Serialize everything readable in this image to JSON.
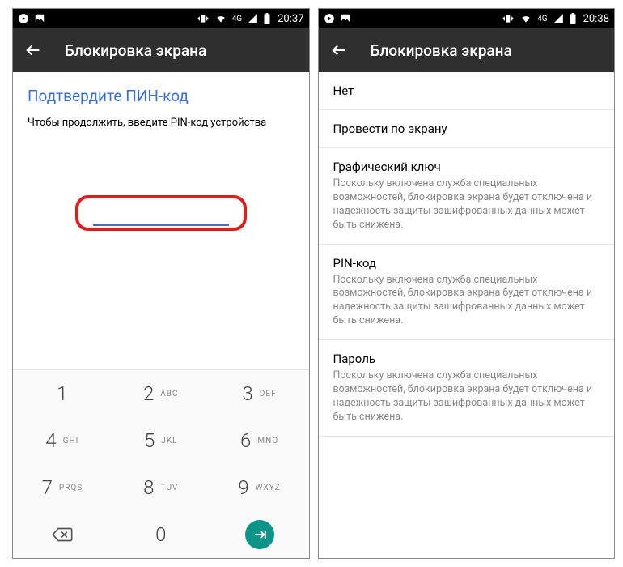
{
  "left": {
    "status": {
      "time": "20:37",
      "net": "4G"
    },
    "appbar_title": "Блокировка экрана",
    "title": "Подтвердите ПИН-код",
    "subtitle": "Чтобы продолжить, введите PIN-код устройства",
    "keys": {
      "k1": {
        "d": "1"
      },
      "k2": {
        "d": "2",
        "l": "ABC"
      },
      "k3": {
        "d": "3",
        "l": "DEF"
      },
      "k4": {
        "d": "4",
        "l": "GHI"
      },
      "k5": {
        "d": "5",
        "l": "JKL"
      },
      "k6": {
        "d": "6",
        "l": "MNO"
      },
      "k7": {
        "d": "7",
        "l": "PRQS"
      },
      "k8": {
        "d": "8",
        "l": "TUV"
      },
      "k9": {
        "d": "9",
        "l": "WXYZ"
      },
      "k0": {
        "d": "0"
      }
    }
  },
  "right": {
    "status": {
      "time": "20:38",
      "net": "4G"
    },
    "appbar_title": "Блокировка экрана",
    "warning_text": "Поскольку включена служба специальных возможностей, блокировка экрана будет отключена и надежность защиты зашифрованных данных может быть снижена.",
    "options": {
      "o0": {
        "title": "Нет"
      },
      "o1": {
        "title": "Провести по экрану"
      },
      "o2": {
        "title": "Графический ключ"
      },
      "o3": {
        "title": "PIN-код"
      },
      "o4": {
        "title": "Пароль"
      }
    }
  }
}
